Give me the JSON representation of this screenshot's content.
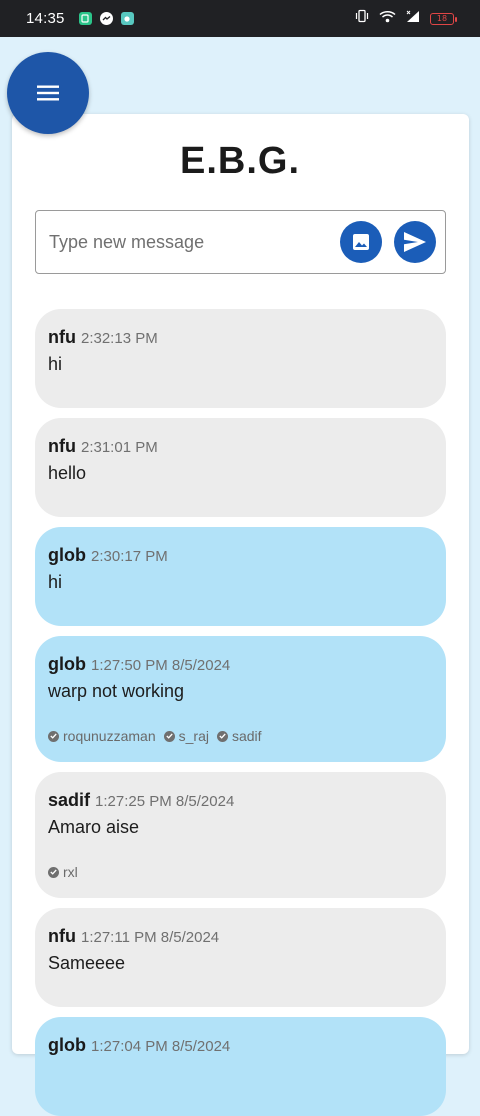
{
  "status_bar": {
    "time": "14:35",
    "battery_level": "18",
    "icons": [
      "app-notification-icon",
      "messenger-icon",
      "chat-app-icon",
      "vibrate-icon",
      "wifi-icon",
      "signal-icon",
      "battery-icon"
    ]
  },
  "header": {
    "title": "E.B.G.",
    "menu_icon": "menu-icon"
  },
  "composer": {
    "placeholder": "Type new message",
    "image_icon": "image-icon",
    "send_icon": "send-icon"
  },
  "colors": {
    "primary": "#1e56a8",
    "own_bubble": "#b2e2f8",
    "other_bubble": "#ececec",
    "background": "#def1fb"
  },
  "messages": [
    {
      "author": "nfu",
      "time": "2:32:13 PM",
      "text": "hi",
      "own": false,
      "seen_by": []
    },
    {
      "author": "nfu",
      "time": "2:31:01 PM",
      "text": "hello",
      "own": false,
      "seen_by": []
    },
    {
      "author": "glob",
      "time": "2:30:17 PM",
      "text": "hi",
      "own": true,
      "seen_by": []
    },
    {
      "author": "glob",
      "time": "1:27:50 PM 8/5/2024",
      "text": "warp not working",
      "own": true,
      "seen_by": [
        "roqunuzzaman",
        "s_raj",
        "sadif"
      ]
    },
    {
      "author": "sadif",
      "time": "1:27:25 PM 8/5/2024",
      "text": "Amaro aise",
      "own": false,
      "seen_by": [
        "rxl"
      ]
    },
    {
      "author": "nfu",
      "time": "1:27:11 PM 8/5/2024",
      "text": "Sameeee",
      "own": false,
      "seen_by": []
    },
    {
      "author": "glob",
      "time": "1:27:04 PM 8/5/2024",
      "text": "",
      "own": true,
      "seen_by": []
    }
  ]
}
